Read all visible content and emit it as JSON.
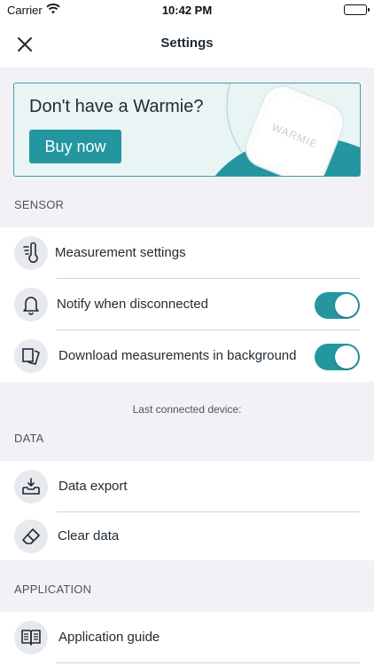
{
  "status_bar": {
    "carrier": "Carrier",
    "time": "10:42 PM"
  },
  "nav": {
    "title": "Settings",
    "close_icon": "close-icon"
  },
  "banner": {
    "title": "Don't have a Warmie?",
    "button_label": "Buy now",
    "device_label": "WARMIE"
  },
  "sections": {
    "sensor": {
      "header": "SENSOR",
      "items": [
        {
          "label": "Measurement settings",
          "icon": "thermometer-icon"
        },
        {
          "label": "Notify when disconnected",
          "icon": "bell-icon",
          "toggle": true
        },
        {
          "label": "Download measurements in background",
          "icon": "download-pages-icon",
          "toggle": true
        }
      ]
    },
    "last_connected_label": "Last connected device:",
    "data": {
      "header": "DATA",
      "items": [
        {
          "label": "Data export",
          "icon": "export-tray-icon"
        },
        {
          "label": "Clear data",
          "icon": "eraser-icon"
        }
      ]
    },
    "application": {
      "header": "APPLICATION",
      "items": [
        {
          "label": "Application guide",
          "icon": "book-icon"
        }
      ]
    }
  },
  "colors": {
    "accent": "#23969f",
    "background": "#f2f2f6",
    "text": "#1f2a33"
  }
}
